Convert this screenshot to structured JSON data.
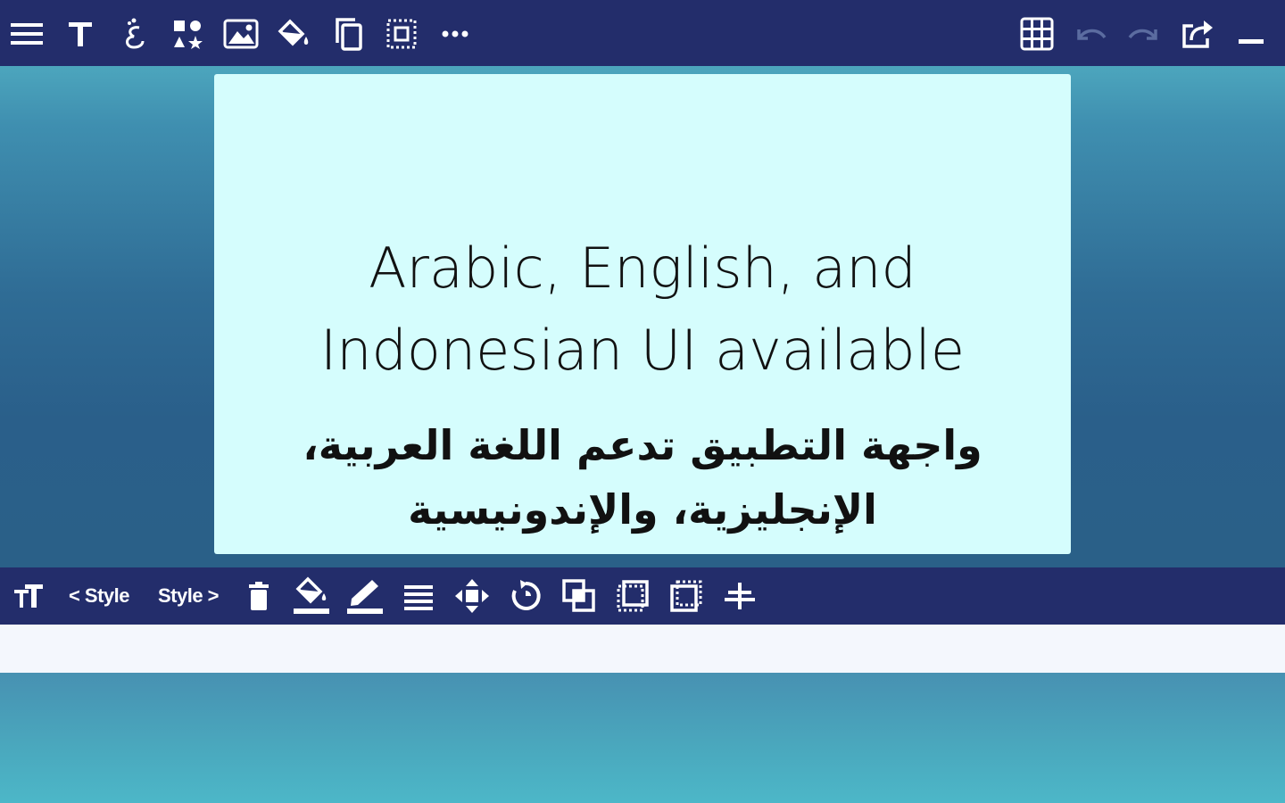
{
  "top_toolbar": {
    "left_icons": [
      "menu-icon",
      "text-icon",
      "arabic-letter-icon",
      "shapes-icon",
      "image-icon",
      "paint-bucket-icon",
      "copy-icon",
      "select-frame-icon",
      "more-icon"
    ],
    "right_icons": [
      "grid-icon",
      "undo-icon",
      "redo-icon",
      "share-icon",
      "minimize-icon"
    ]
  },
  "slide": {
    "background": "#d5fdfd",
    "english_lines": [
      "Arabic, English, and",
      "Indonesian UI available"
    ],
    "arabic_lines": [
      "واجهة التطبيق تدعم اللغة العربية،",
      "الإنجليزية، والإندونيسية"
    ]
  },
  "bottom_toolbar": {
    "prev_style_label": "< Style",
    "next_style_label": "Style >",
    "icons": [
      "text-size-icon",
      "delete-icon",
      "fill-color-icon",
      "pen-color-icon",
      "align-lines-icon",
      "move-icon",
      "rotate-icon",
      "bring-front-icon",
      "layer-up-icon",
      "layer-down-icon",
      "center-align-icon"
    ]
  },
  "colors": {
    "toolbar": "#232d6b",
    "slide": "#d5fdfd",
    "strip": "#f4f7fd"
  }
}
